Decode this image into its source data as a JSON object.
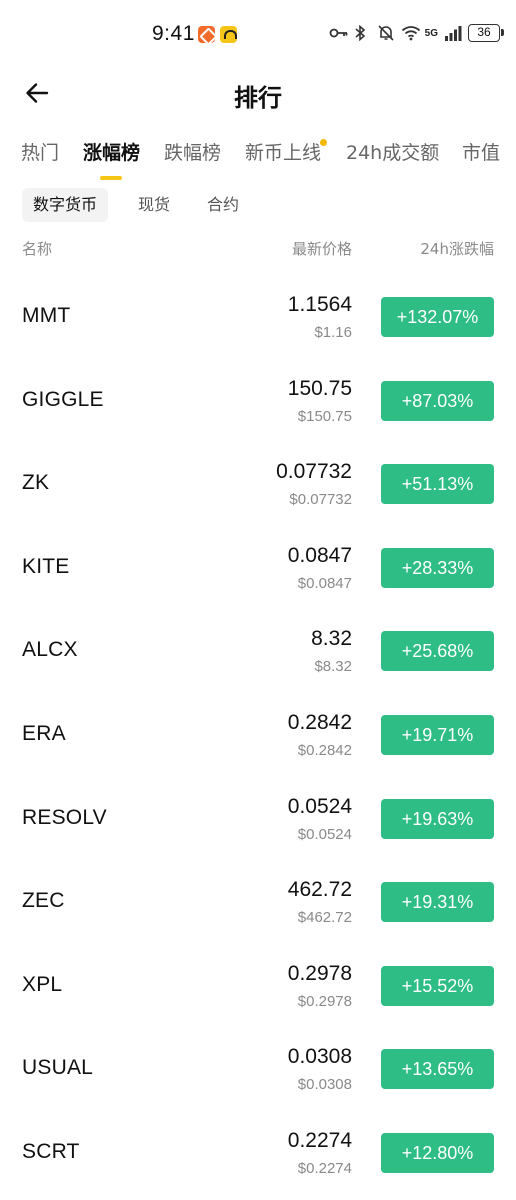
{
  "status_bar": {
    "time": "9:41",
    "network": "5G",
    "battery": "36",
    "icons": [
      "key-icon",
      "bluetooth-icon",
      "mute-icon",
      "wifi-icon",
      "signal-icon",
      "battery-icon"
    ]
  },
  "header": {
    "title": "排行",
    "back_icon": "arrow-left-icon"
  },
  "main_tabs": [
    {
      "label": "热门",
      "active": false
    },
    {
      "label": "涨幅榜",
      "active": true
    },
    {
      "label": "跌幅榜",
      "active": false
    },
    {
      "label": "新币上线",
      "active": false,
      "dot": true
    },
    {
      "label": "24h成交额",
      "active": false
    },
    {
      "label": "市值",
      "active": false
    }
  ],
  "sub_tabs": [
    {
      "label": "数字货币",
      "active": true
    },
    {
      "label": "现货",
      "active": false
    },
    {
      "label": "合约",
      "active": false
    }
  ],
  "columns": {
    "name": "名称",
    "price": "最新价格",
    "change": "24h涨跌幅"
  },
  "colors": {
    "accent": "#f5c518",
    "up": "#2ebd85"
  },
  "rows": [
    {
      "symbol": "MMT",
      "price": "1.1564",
      "usd": "$1.16",
      "change": "+132.07%"
    },
    {
      "symbol": "GIGGLE",
      "price": "150.75",
      "usd": "$150.75",
      "change": "+87.03%"
    },
    {
      "symbol": "ZK",
      "price": "0.07732",
      "usd": "$0.07732",
      "change": "+51.13%"
    },
    {
      "symbol": "KITE",
      "price": "0.0847",
      "usd": "$0.0847",
      "change": "+28.33%"
    },
    {
      "symbol": "ALCX",
      "price": "8.32",
      "usd": "$8.32",
      "change": "+25.68%"
    },
    {
      "symbol": "ERA",
      "price": "0.2842",
      "usd": "$0.2842",
      "change": "+19.71%"
    },
    {
      "symbol": "RESOLV",
      "price": "0.0524",
      "usd": "$0.0524",
      "change": "+19.63%"
    },
    {
      "symbol": "ZEC",
      "price": "462.72",
      "usd": "$462.72",
      "change": "+19.31%"
    },
    {
      "symbol": "XPL",
      "price": "0.2978",
      "usd": "$0.2978",
      "change": "+15.52%"
    },
    {
      "symbol": "USUAL",
      "price": "0.0308",
      "usd": "$0.0308",
      "change": "+13.65%"
    },
    {
      "symbol": "SCRT",
      "price": "0.2274",
      "usd": "$0.2274",
      "change": "+12.80%"
    }
  ]
}
